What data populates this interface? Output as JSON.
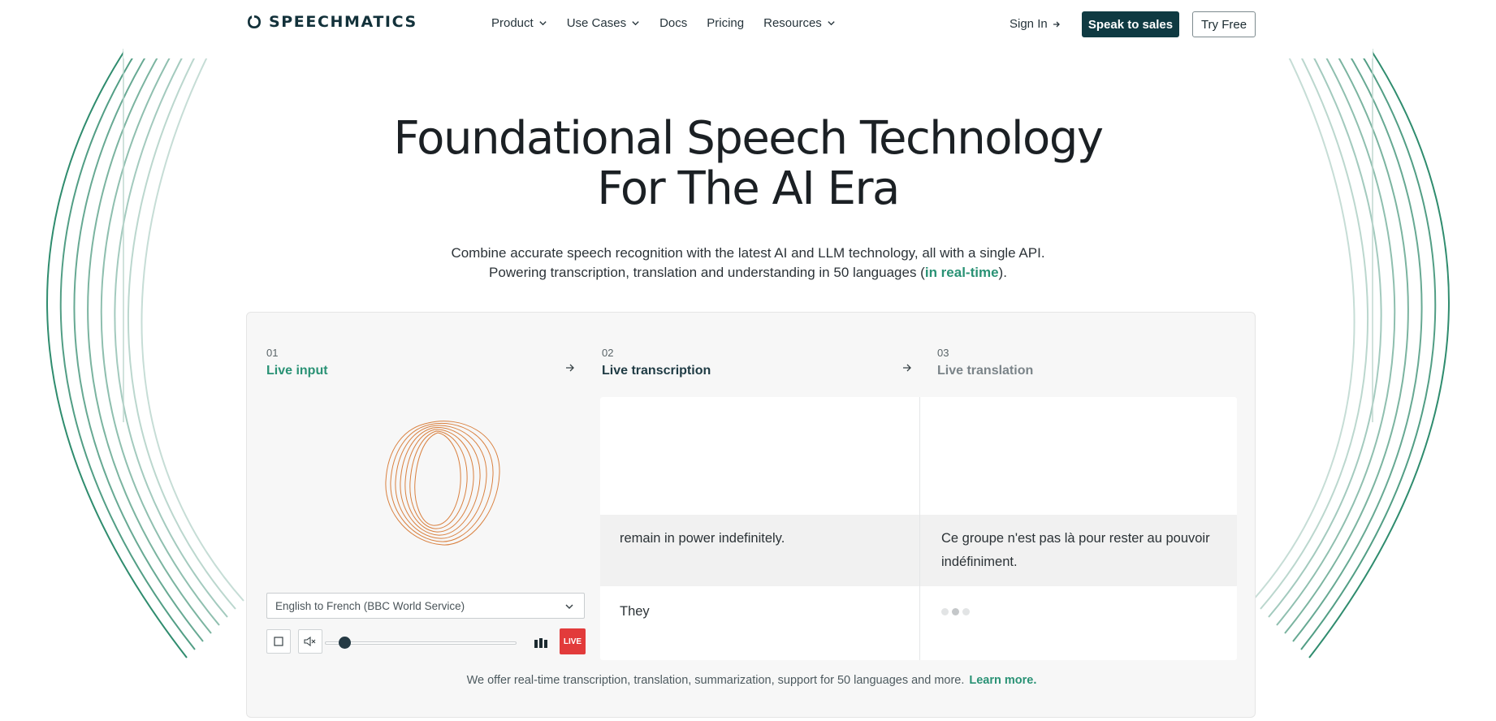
{
  "nav": {
    "brand": "SPEECHMATICS",
    "links": [
      {
        "label": "Product",
        "has_menu": true
      },
      {
        "label": "Use Cases",
        "has_menu": true
      },
      {
        "label": "Docs",
        "has_menu": false
      },
      {
        "label": "Pricing",
        "has_menu": false
      },
      {
        "label": "Resources",
        "has_menu": true
      }
    ],
    "sign_in": "Sign In",
    "speak_to_sales": "Speak to sales",
    "try_free": "Try Free"
  },
  "hero": {
    "title_line1": "Foundational Speech Technology",
    "title_line2": "For The AI Era",
    "sub_line1": "Combine accurate speech recognition with the latest AI and LLM technology, all with a single API.",
    "sub_line2_pre": "Powering transcription, translation and understanding in 50 languages (",
    "sub_line2_highlight": "in real-time",
    "sub_line2_post": ")."
  },
  "demo": {
    "steps": [
      {
        "num": "01",
        "title": "Live input"
      },
      {
        "num": "02",
        "title": "Live transcription"
      },
      {
        "num": "03",
        "title": "Live translation"
      }
    ],
    "source_select": "English to French (BBC World Service)",
    "live_badge": "LIVE",
    "playback_progress": 0.0,
    "transcription": {
      "previous": "remain in power indefinitely.",
      "current": "They"
    },
    "translation": {
      "previous": "Ce groupe n'est pas là pour rester au pouvoir indéfiniment."
    },
    "footer_text": "We offer real-time transcription, translation, summarization, support for 50 languages and more.",
    "footer_link": "Learn more."
  },
  "colors": {
    "brand_dark": "#0f3a42",
    "accent_green": "#2a9275",
    "live_red": "#e23b3b",
    "orb_orange": "#d9803f"
  },
  "icons": [
    "logo-mark-icon",
    "chevron-down-icon",
    "arrow-right-icon",
    "stop-icon",
    "mute-icon",
    "bars-icon"
  ]
}
